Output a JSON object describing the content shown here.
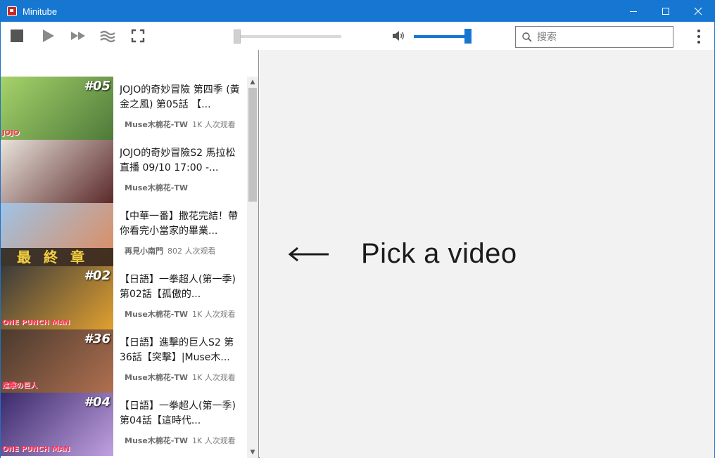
{
  "window": {
    "title": "Minitube",
    "minimize": "—",
    "maximize": "☐",
    "close": "✕"
  },
  "toolbar": {
    "stop_icon": "stop-icon",
    "play_icon": "play-icon",
    "skip_icon": "skip-forward-icon",
    "definition_icon": "wave-definition-icon",
    "fullscreen_icon": "fullscreen-icon",
    "volume_icon": "speaker-icon",
    "seek_progress": 0.0,
    "volume_level": 0.92,
    "search": {
      "placeholder": "搜索",
      "value": ""
    },
    "menu_icon": "vertical-dots-icon"
  },
  "videos": [
    {
      "title": "JOJO的奇妙冒險 第四季 (黃金之風) 第05話 【...",
      "channel": "Muse木棉花-TW",
      "views": "1K 人次观看",
      "tag": "#05",
      "cap": "JOJO",
      "colors": [
        "#a6d36a",
        "#4e7a3a"
      ]
    },
    {
      "title": "JOJO的奇妙冒險S2 馬拉松直播 09/10 17:00 -...",
      "channel": "Muse木棉花-TW",
      "views": "",
      "tag": "",
      "cap": "",
      "colors": [
        "#e9e3dc",
        "#5b2a2a"
      ]
    },
    {
      "title": "【中華一番】撒花完結！帶你看完小當家的畢業...",
      "channel": "再見小南門",
      "views": "802 人次观看",
      "tag": "",
      "cap": "最終章",
      "colors": [
        "#9fc3e6",
        "#e08a5a"
      ]
    },
    {
      "title": "【日語】一拳超人(第一季) 第02話【孤傲的...",
      "channel": "Muse木棉花-TW",
      "views": "1K 人次观看",
      "tag": "#02",
      "cap": "ONE PUNCH MAN",
      "colors": [
        "#3b3b3b",
        "#e0a030"
      ]
    },
    {
      "title": "【日語】進擊的巨人S2 第36話【突擊】|Muse木...",
      "channel": "Muse木棉花-TW",
      "views": "1K 人次观看",
      "tag": "#36",
      "cap": "進擊の巨人",
      "colors": [
        "#4a3a2e",
        "#b07050"
      ]
    },
    {
      "title": "【日語】一拳超人(第一季) 第04話【這時代...",
      "channel": "Muse木棉花-TW",
      "views": "1K 人次观看",
      "tag": "#04",
      "cap": "ONE PUNCH MAN",
      "colors": [
        "#3a2a6a",
        "#c0a0e0"
      ]
    }
  ],
  "scrollbar": {
    "up": "▲",
    "down": "▼"
  },
  "main": {
    "arrow": "⟵",
    "message": "Pick a video"
  }
}
